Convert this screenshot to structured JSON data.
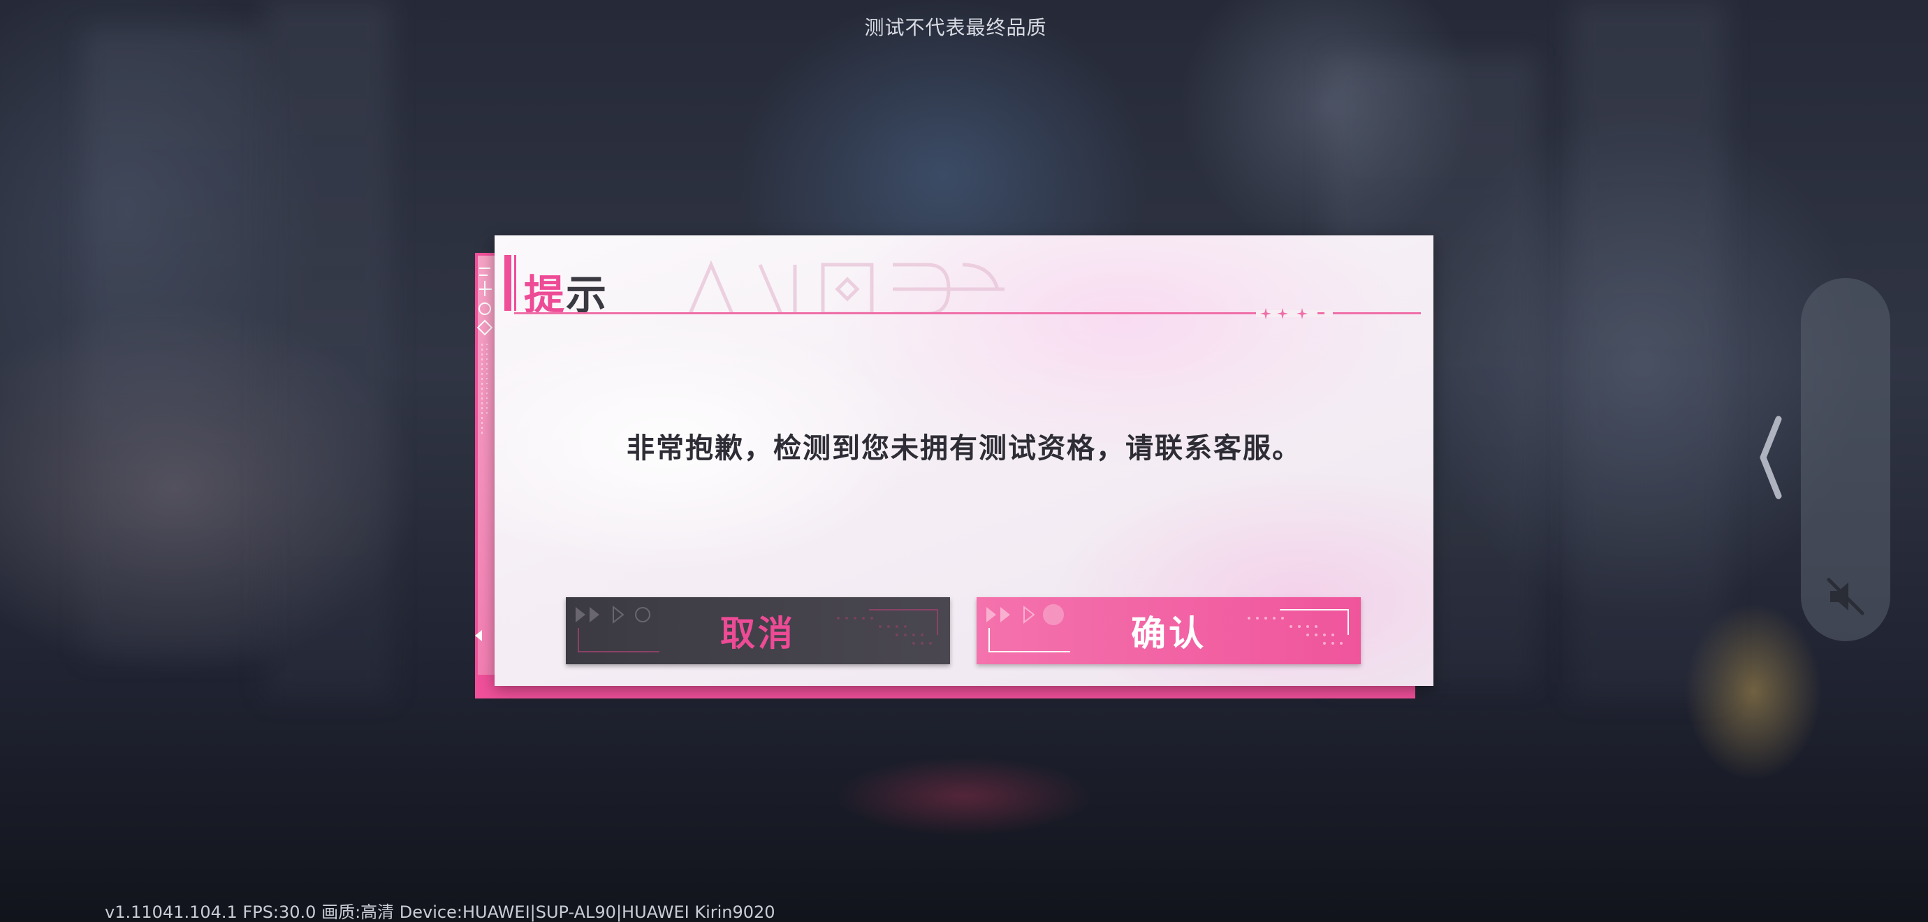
{
  "top_notice": "测试不代表最终品质",
  "version_info": "v1.11041.104.1 FPS:30.0 画质:高清 Device:HUAWEI|SUP-AL90|HUAWEI Kirin9020",
  "dialog": {
    "title_first": "提",
    "title_rest": "示",
    "message": "非常抱歉，检测到您未拥有测试资格，请联系客服。",
    "cancel_label": "取消",
    "confirm_label": "确认"
  },
  "side_panel": {
    "expand_icon": "chevron-left-icon",
    "mute_icon": "speaker-muted-icon"
  },
  "colors": {
    "accent": "#ef4e98",
    "cancel_bg": "#3b3a42",
    "confirm_bg": "#f0559c",
    "text_dark": "#2e2d36"
  }
}
